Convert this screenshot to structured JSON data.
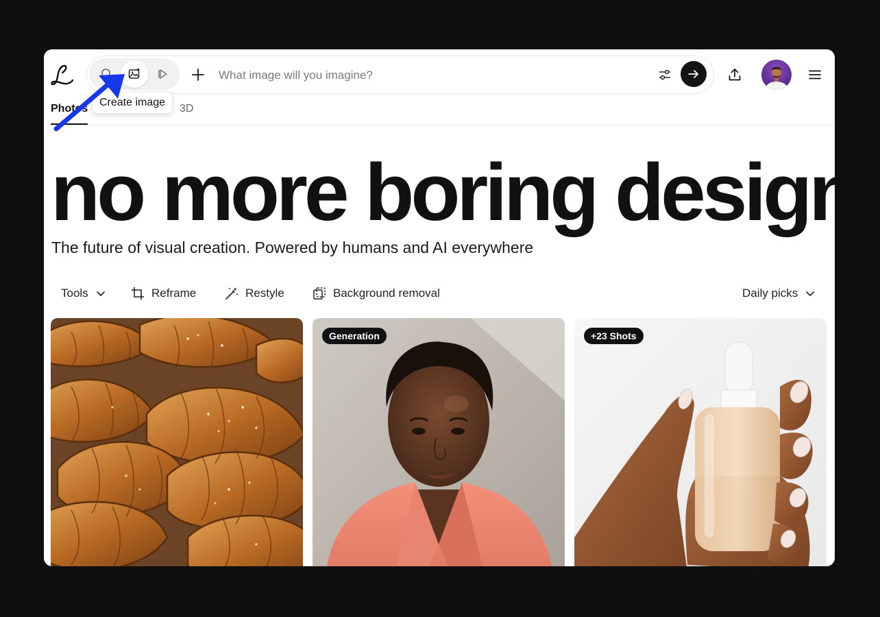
{
  "header": {
    "search": {
      "placeholder": "What image will you imagine?",
      "modes": [
        {
          "name": "search",
          "active": false
        },
        {
          "name": "create-image",
          "active": true
        },
        {
          "name": "video",
          "active": false
        }
      ]
    },
    "tooltip": "Create image"
  },
  "tabs": [
    {
      "label": "Photos",
      "active": true
    },
    {
      "label": "3D",
      "active": false
    }
  ],
  "hero": {
    "title": "no more boring design",
    "subtitle": "The future of visual creation. Powered by humans and AI everywhere"
  },
  "toolbar": {
    "tools_label": "Tools",
    "reframe_label": "Reframe",
    "restyle_label": "Restyle",
    "bg_removal_label": "Background removal",
    "sort_label": "Daily picks"
  },
  "cards": [
    {
      "subject": "croissants",
      "badge": ""
    },
    {
      "subject": "portrait",
      "badge": "Generation"
    },
    {
      "subject": "serum-bottle",
      "badge": "+23 Shots"
    }
  ],
  "colors": {
    "accent_arrow": "#1638e8",
    "go_button": "#141414",
    "frame": "#0f0f10"
  }
}
